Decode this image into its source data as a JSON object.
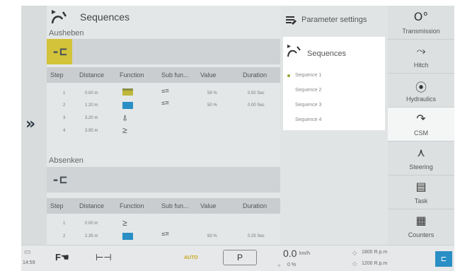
{
  "main": {
    "title": "Sequences",
    "raise": {
      "label": "Ausheben",
      "mode_icon": "raise-mode-icon",
      "columns": [
        "Step",
        "Distance",
        "Function",
        "Sub fun...",
        "Value",
        "Duration"
      ],
      "rows": [
        {
          "step": "1",
          "distance": "0.00 m",
          "function_icon": "hitch-up-green",
          "subfn": "≤≡",
          "value": "59 %",
          "duration": "0.50 Sec"
        },
        {
          "step": "2",
          "distance": "1.20 m",
          "function_icon": "hitch-blue",
          "subfn": "≤≡",
          "value": "50 %",
          "duration": "0.00 Sec"
        },
        {
          "step": "3",
          "distance": "3.20 m",
          "function_icon": "plough-icon",
          "subfn": "",
          "value": "",
          "duration": ""
        },
        {
          "step": "4",
          "distance": "3.95 m",
          "function_icon": "turn-icon",
          "subfn": "",
          "value": "",
          "duration": ""
        }
      ]
    },
    "lower": {
      "label": "Absenken",
      "columns": [
        "Step",
        "Distance",
        "Function",
        "Sub fun...",
        "Value",
        "Duration"
      ],
      "rows": [
        {
          "step": "1",
          "distance": "0.00 m",
          "function_icon": "turn-icon",
          "subfn": "",
          "value": "",
          "duration": ""
        },
        {
          "step": "2",
          "distance": "2.35 m",
          "function_icon": "hitch-blue",
          "subfn": "≤≡",
          "value": "83 %",
          "duration": "0.25 Sec"
        }
      ]
    }
  },
  "popup": {
    "header": "Parameter settings",
    "list_title": "Sequences",
    "items": [
      "Sequence 1",
      "Sequence 2",
      "Sequence 3",
      "Sequence 4"
    ],
    "selected_index": 0
  },
  "sidebar": {
    "items": [
      {
        "label": "Transmission",
        "icon": "transmission-icon",
        "glyph": "O°"
      },
      {
        "label": "Hitch",
        "icon": "hitch-icon",
        "glyph": "⤳"
      },
      {
        "label": "Hydraulics",
        "icon": "hydraulics-icon",
        "glyph": "⦿"
      },
      {
        "label": "CSM",
        "icon": "csm-icon",
        "glyph": "↷"
      },
      {
        "label": "Steering",
        "icon": "steering-icon",
        "glyph": "⋏"
      },
      {
        "label": "Task",
        "icon": "task-icon",
        "glyph": "▤"
      },
      {
        "label": "Counters",
        "icon": "counters-icon",
        "glyph": "▦"
      }
    ],
    "active_index": 3
  },
  "status": {
    "time": "14:59",
    "speed_value": "0.0",
    "speed_unit": "km/h",
    "slip": "0 %",
    "auto": "AUTO",
    "gear": "P",
    "rpm1": "1800 R.p.m",
    "rpm2": "1200 R.p.m"
  },
  "colors": {
    "accent_green": "#d2c33a",
    "accent_blue": "#2a8fc4",
    "panel": "#e4e7e8",
    "header": "#c9cdcf"
  }
}
